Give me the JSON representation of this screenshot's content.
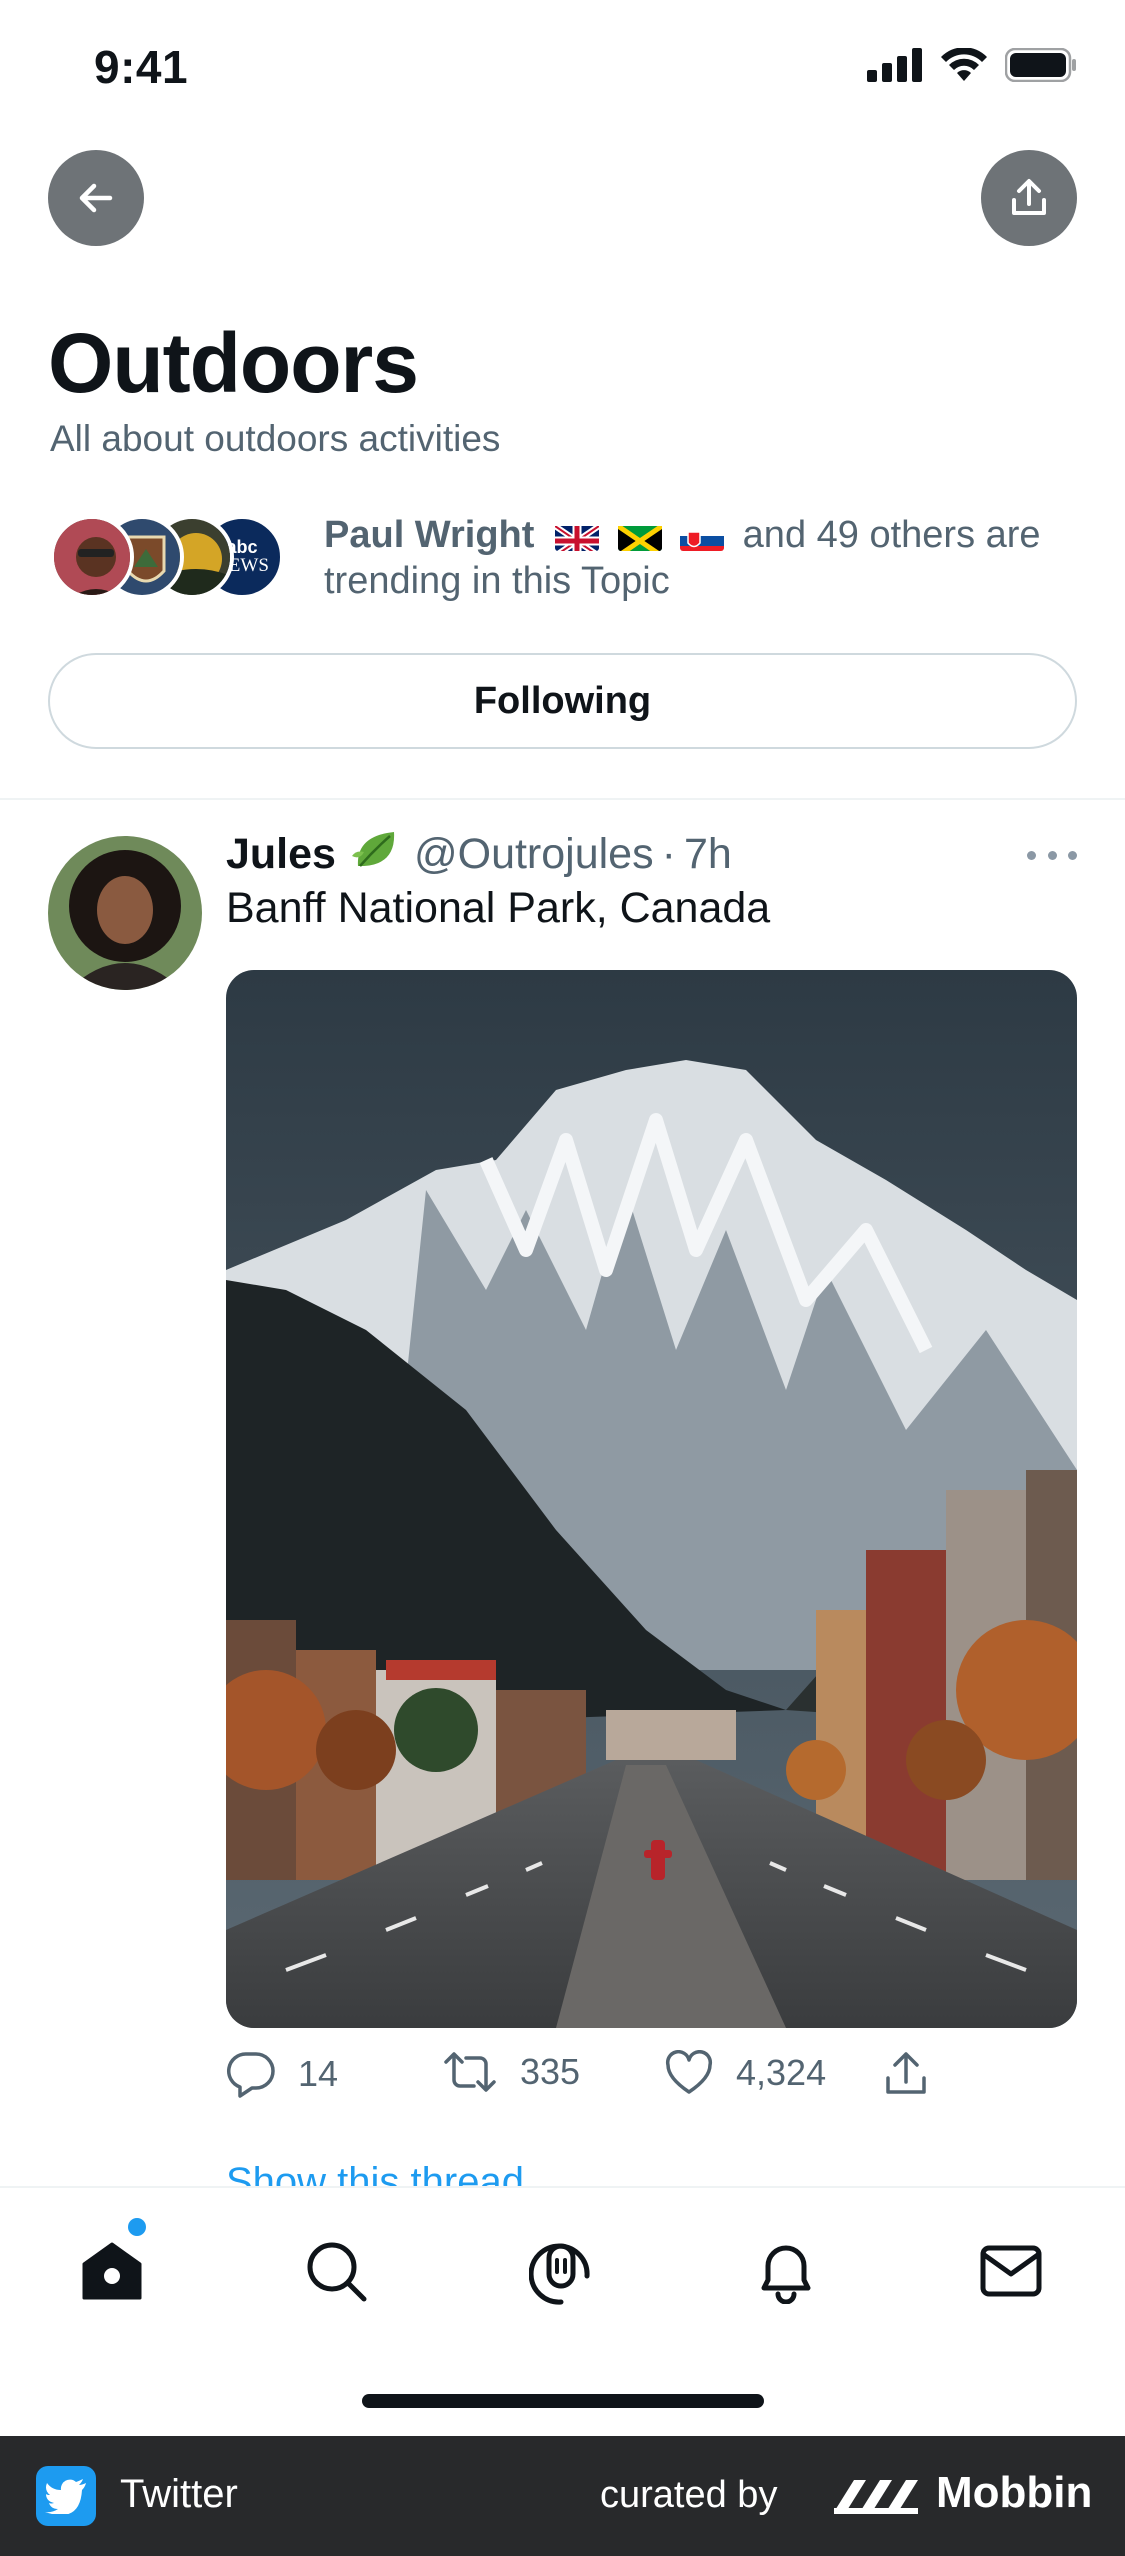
{
  "status": {
    "time": "9:41"
  },
  "topic": {
    "title": "Outdoors",
    "subtitle": "All about outdoors activities",
    "trending_name": "Paul Wright",
    "trending_rest": "and 49 others are trending in this Topic",
    "following_label": "Following",
    "avatar_labels": [
      "abc",
      "NEWS"
    ]
  },
  "tweet": {
    "name": "Jules",
    "handle": "@Outrojules",
    "separator": "·",
    "time": "7h",
    "text": "Banff National Park, Canada",
    "replies": "14",
    "retweets": "335",
    "likes": "4,324",
    "show_thread": "Show this thread"
  },
  "tabs": [
    "home",
    "search",
    "spaces",
    "notifications",
    "messages"
  ],
  "footer": {
    "app_name": "Twitter",
    "curated_by": "curated by",
    "brand": "Mobbin"
  },
  "colors": {
    "accent": "#1d9bf0",
    "text_primary": "#0f1419",
    "text_secondary": "#536471",
    "footer_bg": "#28292b"
  }
}
